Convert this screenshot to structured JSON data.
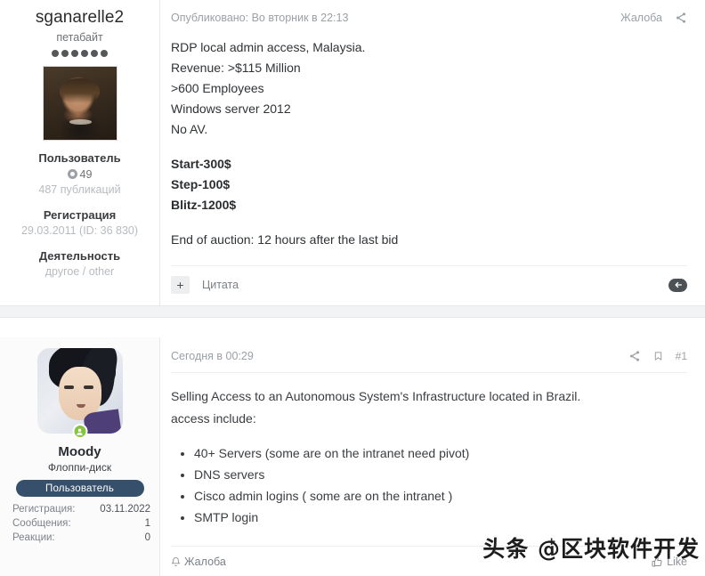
{
  "post1": {
    "user": {
      "name": "sganarelle2",
      "rank": "петабайт",
      "dots": 6,
      "usergroup": "Пользователь",
      "trophy_points": "49",
      "messages": "487 публикаций",
      "registered_label": "Регистрация",
      "registered_value": "29.03.2011 (ID: 36 830)",
      "activity_label": "Деятельность",
      "activity_value": "другое / other",
      "avatar_name": "renaissance-portrait-avatar"
    },
    "header": {
      "date": "Опубликовано: Во вторник в 22:13",
      "report": "Жалоба",
      "share_icon": "share-icon"
    },
    "body": {
      "lines": [
        "RDP local admin access, Malaysia.",
        "Revenue: >$115 Million",
        ">600 Employees",
        "Windows server 2012",
        "No AV."
      ],
      "price_lines": [
        "Start-300$",
        "Step-100$",
        "Blitz-1200$"
      ],
      "footer_note": "End of auction: 12 hours after the last bid"
    },
    "footer": {
      "plus_label": "+",
      "quote": "Цитата",
      "reply_icon": "reply-arrow-icon"
    }
  },
  "post2": {
    "user": {
      "name": "Moody",
      "rank": "Флоппи-диск",
      "usergroup": "Пользователь",
      "avatar_name": "anime-character-avatar",
      "online_icon": "online-status-icon",
      "stats": [
        {
          "label": "Регистрация:",
          "value": "03.11.2022"
        },
        {
          "label": "Сообщения:",
          "value": "1"
        },
        {
          "label": "Реакции:",
          "value": "0"
        }
      ]
    },
    "header": {
      "date": "Сегодня в 00:29",
      "share_icon": "share-icon",
      "bookmark_icon": "bookmark-icon",
      "post_number": "#1"
    },
    "body": {
      "intro_line1": "Selling Access to an Autonomous System's Infrastructure located in Brazil.",
      "intro_line2": "access include:",
      "bullets": [
        "40+ Servers (some are on the intranet need pivot)",
        "DNS servers",
        "Cisco admin logins ( some are on the intranet )",
        "SMTP login"
      ]
    },
    "footer": {
      "report": "Жалоба",
      "report_icon": "bell-report-icon",
      "like": "Like",
      "like_icon": "thumbs-up-icon"
    }
  },
  "watermark": {
    "plus": "+",
    "text": "头条 @区块软件开发"
  },
  "colors": {
    "accent": "#36506b",
    "online": "#87c440",
    "text": "#2f3336",
    "muted": "#9ba0a6"
  }
}
